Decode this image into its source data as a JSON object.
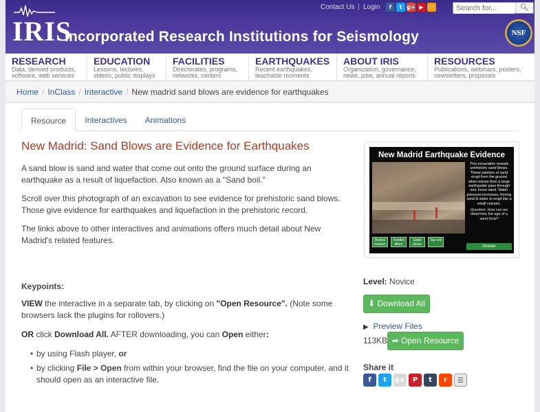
{
  "header": {
    "logo_text": "IRIS",
    "site_title": "Incorporated Research Institutions for Seismology",
    "contact": "Contact Us",
    "login": "Login",
    "search_placeholder": "Search for...",
    "nsf": "NSF",
    "social_icons": [
      "facebook-icon",
      "twitter-icon",
      "google-plus-icon",
      "youtube-icon",
      "rss-icon"
    ]
  },
  "nav": [
    {
      "title": "RESEARCH",
      "sub1": "Data, derived products,",
      "sub2": "software, web services"
    },
    {
      "title": "EDUCATION",
      "sub1": "Lessons, lectures,",
      "sub2": "videos, public displays"
    },
    {
      "title": "FACILITIES",
      "sub1": "Directorates, programs,",
      "sub2": "networks, centers"
    },
    {
      "title": "EARTHQUAKES",
      "sub1": "Recent earthquakes,",
      "sub2": "teachable moments"
    },
    {
      "title": "ABOUT IRIS",
      "sub1": "Organization, governance,",
      "sub2": "news, jobs, annual reports"
    },
    {
      "title": "RESOURCES",
      "sub1": "Publications, webinars, posters,",
      "sub2": "newsletters, proposals"
    }
  ],
  "breadcrumb": [
    "Home",
    "InClass",
    "Interactive",
    "New madrid sand blows are evidence for earthquakes"
  ],
  "tabs": [
    "Resource",
    "Interactives",
    "Animations"
  ],
  "resource": {
    "title": "New Madrid: Sand Blows are Evidence for Earthquakes",
    "p1": "A sand blow is sand and water that come out onto the ground surface during an earthquake as a result of liquefaction. Also known as a \"Sand boil.\"",
    "p2": "Scroll over this photograph of an excavation to see evidence for prehistoric sand blows. Those give evidence for earthquakes and liquefaction in the prehistoric record.",
    "p3": "The links above to other interactives and animations offers much detail about New Madrid's related features."
  },
  "thumbnail": {
    "title": "New Madrid Earthquake Evidence",
    "side_text": "This excavation reveals prehistoric sand blows. These patches of sand erupt from the ground when waves from a large earthquake pass through wet, loose sand. Water pressure increases, forcing sand & water to erupt like a small volcano.",
    "question": "Question: How can we determine the age of a sand blow?",
    "buttons": [
      "Buried horizon",
      "Feeder dikes",
      "Sand blows",
      "Top soil"
    ],
    "answer": "Answer"
  },
  "keypoints": {
    "heading": "Keypoints:",
    "view_lead": "VIEW",
    "view_mid": " the interactive in a separate tab, by clicking on ",
    "view_link": "\"Open Resource\".",
    "view_tail": " (Note some browsers lack the plugins for rollovers.)",
    "or_lead": "OR",
    "or_mid": " click ",
    "or_dl": "Download All.",
    "or_after": "  AFTER downloading, you can ",
    "or_open": "Open",
    "or_either": " either",
    "or_colon": ":",
    "b1_pre": "by using Flash player, ",
    "b1_bold": "or",
    "b2_pre": "by clicking ",
    "b2_bold": "File > Open",
    "b2_tail": " from within your browser, find the file on your computer, and it should open as an interactive file."
  },
  "sidebar": {
    "level_label": "Level:",
    "level_value": " Novice",
    "download_label": "Download All",
    "preview_label": "Preview Files",
    "size": "113KB",
    "open_label": "Open Resource",
    "share_heading": "Share it",
    "share_icons": [
      "facebook-icon",
      "twitter-icon",
      "google-plus-icon",
      "pinterest-icon",
      "tumblr-icon",
      "reddit-icon",
      "email-icon"
    ]
  }
}
